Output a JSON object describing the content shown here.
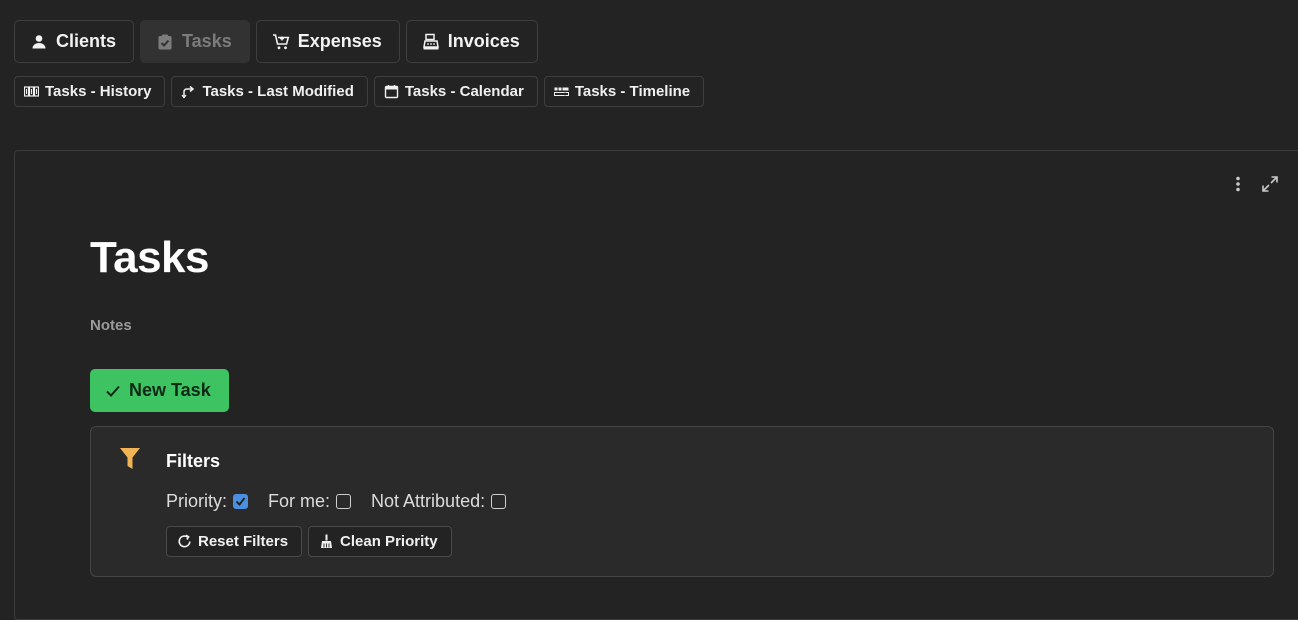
{
  "nav": {
    "tabs": [
      {
        "label": "Clients",
        "icon": "person-icon"
      },
      {
        "label": "Tasks",
        "icon": "clipboard-check-icon",
        "active": true
      },
      {
        "label": "Expenses",
        "icon": "cart-icon"
      },
      {
        "label": "Invoices",
        "icon": "cash-register-icon"
      }
    ]
  },
  "subnav": {
    "items": [
      {
        "label": "Tasks - History",
        "icon": "history-icon"
      },
      {
        "label": "Tasks - Last Modified",
        "icon": "branch-icon"
      },
      {
        "label": "Tasks - Calendar",
        "icon": "calendar-icon"
      },
      {
        "label": "Tasks - Timeline",
        "icon": "timeline-icon"
      }
    ]
  },
  "page": {
    "title": "Tasks",
    "notes": "Notes",
    "new_task_label": "New Task"
  },
  "filters": {
    "title": "Filters",
    "options": [
      {
        "label": "Priority:",
        "checked": true
      },
      {
        "label": "For me:",
        "checked": false
      },
      {
        "label": "Not Attributed:",
        "checked": false
      }
    ],
    "reset_label": "Reset Filters",
    "clean_label": "Clean Priority"
  },
  "colors": {
    "background": "#232323",
    "accent_green": "#3ec363",
    "filter_icon": "#f0b455",
    "checkbox_checked": "#4a8fe0"
  }
}
